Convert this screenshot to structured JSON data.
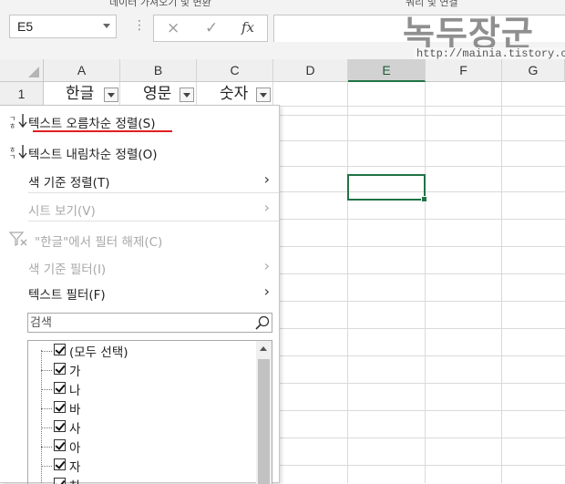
{
  "ribbon": {
    "left_label": "데이터 가져오기 및 변환",
    "right_label": "쿼리 및 연결"
  },
  "formula_bar": {
    "name_box": "E5",
    "cancel_glyph": "×",
    "enter_glyph": "✓",
    "fx_glyph": "fx",
    "formula_value": ""
  },
  "watermark": {
    "text": "녹두장군",
    "url": "http://mainia.tistory.com"
  },
  "columns": [
    "A",
    "B",
    "C",
    "D",
    "E",
    "F",
    "G"
  ],
  "selected_column": "E",
  "rows": [
    "1"
  ],
  "header_cells": {
    "a": "한글",
    "b": "영문",
    "c": "숫자"
  },
  "active_cell": "E5",
  "menu": {
    "sort_asc": "텍스트 오름차순 정렬(S)",
    "sort_desc": "텍스트 내림차순 정렬(O)",
    "sort_by_color": "색 기준 정렬(T)",
    "sheet_view": "시트 보기(V)",
    "clear_filter": "\"한글\"에서 필터 해제(C)",
    "filter_by_color": "색 기준 필터(I)",
    "text_filter": "텍스트 필터(F)",
    "search_placeholder": "검색",
    "items": [
      {
        "label": "(모두 선택)",
        "checked": true
      },
      {
        "label": "가",
        "checked": true
      },
      {
        "label": "나",
        "checked": true
      },
      {
        "label": "바",
        "checked": true
      },
      {
        "label": "사",
        "checked": true
      },
      {
        "label": "아",
        "checked": true
      },
      {
        "label": "자",
        "checked": true
      },
      {
        "label": "차",
        "checked": true
      }
    ]
  },
  "colors": {
    "accent_green": "#217346",
    "underline_red": "#e02020"
  }
}
